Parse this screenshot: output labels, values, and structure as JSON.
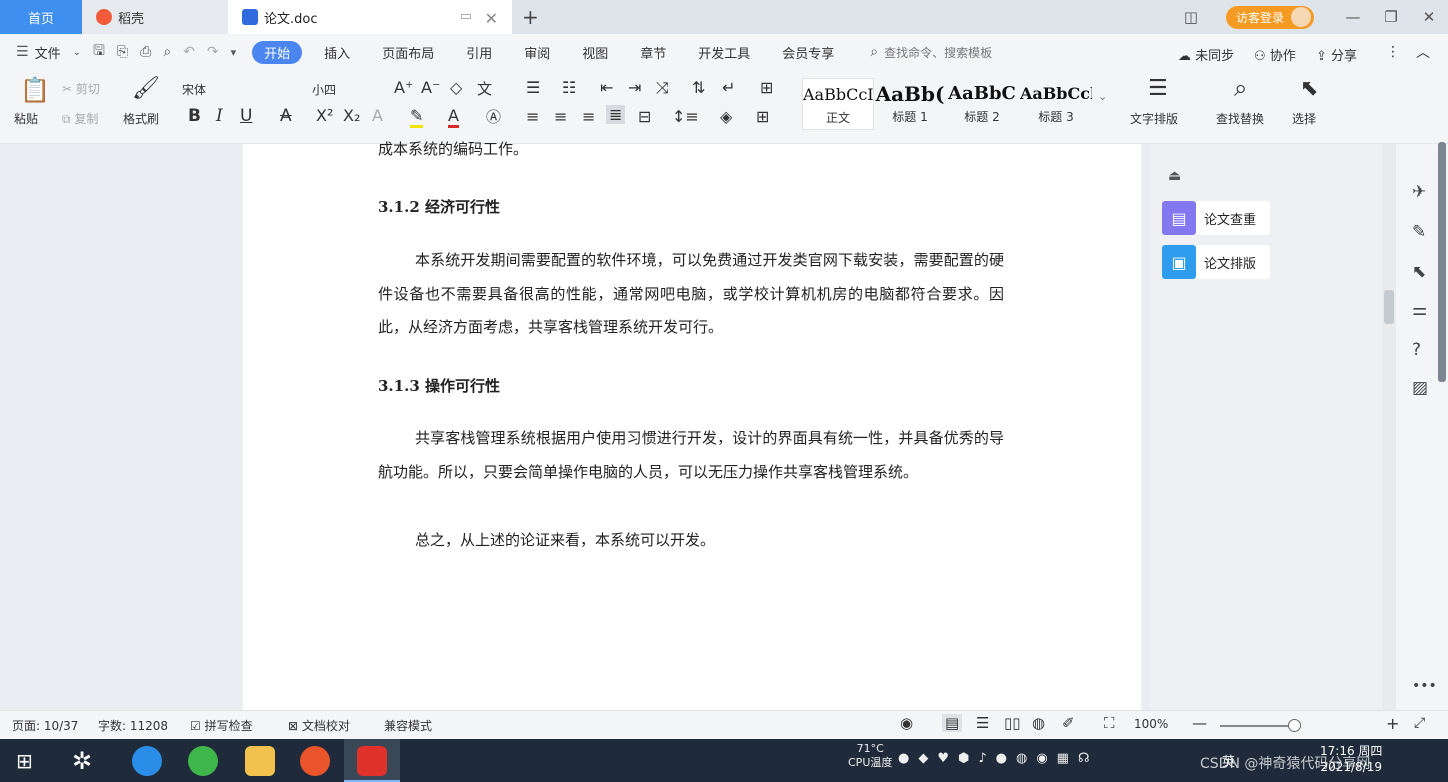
{
  "tabs": {
    "home": "首页",
    "daoke": "稻壳",
    "doc": "论文.doc",
    "login": "访客登录"
  },
  "menu": {
    "file": "文件",
    "items": [
      "开始",
      "插入",
      "页面布局",
      "引用",
      "审阅",
      "视图",
      "章节",
      "开发工具",
      "会员专享"
    ],
    "search": "查找命令、搜索模板",
    "sync": "未同步",
    "collab": "协作",
    "share": "分享"
  },
  "ribbon": {
    "paste": "粘贴",
    "cut": "剪切",
    "copy": "复制",
    "format_painter": "格式刷",
    "font": "宋体",
    "size": "小四",
    "styles": [
      {
        "preview": "AaBbCcI",
        "label": "正文"
      },
      {
        "preview": "AaBb(",
        "label": "标题 1"
      },
      {
        "preview": "AaBbC",
        "label": "标题 2"
      },
      {
        "preview": "AaBbCcl",
        "label": "标题 3"
      }
    ],
    "text_layout": "文字排版",
    "find_replace": "查找替换",
    "select": "选择"
  },
  "document": {
    "line_top": "成本系统的编码工作。",
    "h312": "3.1.2  经济可行性",
    "p_econ": "本系统开发期间需要配置的软件环境，可以免费通过开发类官网下载安装，需要配置的硬件设备也不需要具备很高的性能，通常网吧电脑，或学校计算机机房的电脑都符合要求。因此，从经济方面考虑，共享客栈管理系统开发可行。",
    "h313": "3.1.3  操作可行性",
    "p_oper": "共享客栈管理系统根据用户使用习惯进行开发，设计的界面具有统一性，并具备优秀的导航功能。所以，只要会简单操作电脑的人员，可以无压力操作共享客栈管理系统。",
    "p_sum": "总之，从上述的论证来看，本系统可以开发。"
  },
  "right_pane": {
    "check": "论文查重",
    "layout": "论文排版"
  },
  "status": {
    "page": "页面: 10/37",
    "words": "字数: 11208",
    "spell": "拼写检查",
    "proof": "文档校对",
    "compat": "兼容模式",
    "zoom": "100%"
  },
  "taskbar": {
    "temp": "71°C",
    "cpu": "CPU温度",
    "ime": "英",
    "time": "17:16 周四",
    "date": "2021/8/19",
    "watermark": "CSDN @神奇猿代码分享网"
  },
  "colors": {
    "accent": "#4b86f0",
    "tab_home": "#3f8ff0",
    "login": "#f59a23"
  }
}
